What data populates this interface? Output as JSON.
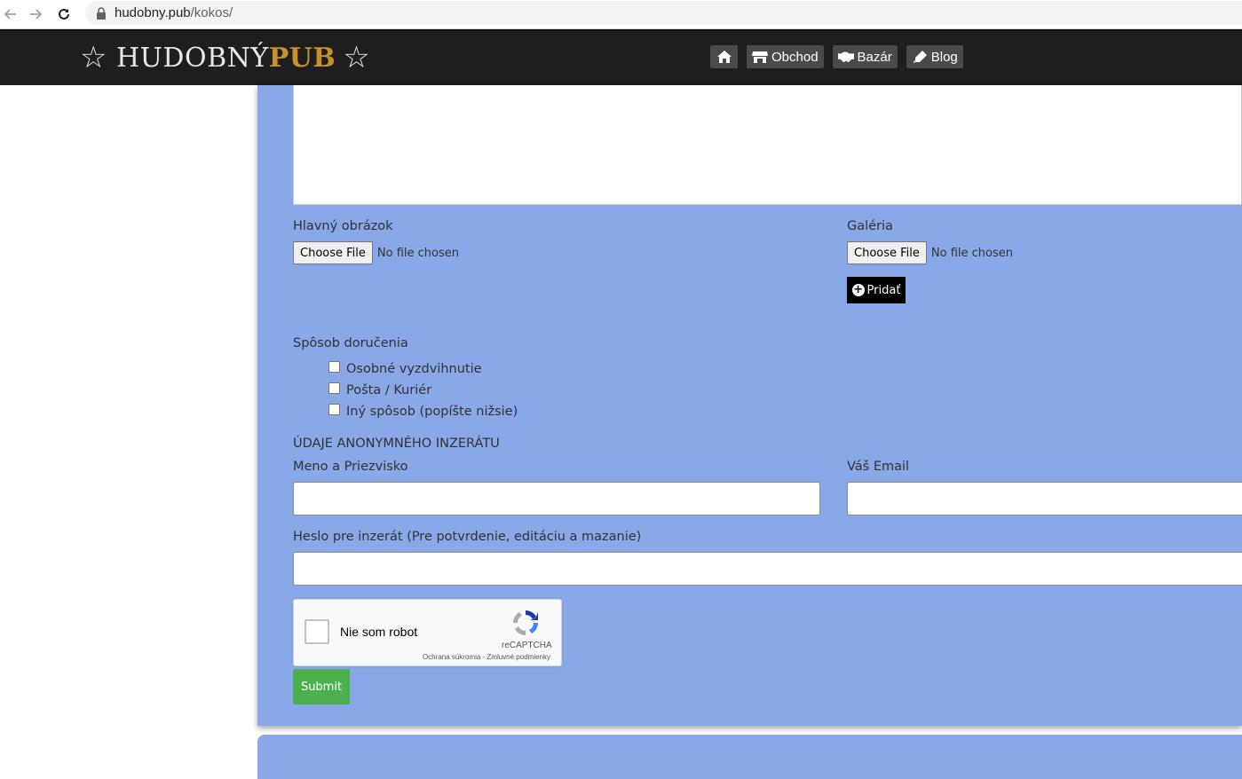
{
  "browser": {
    "url_host": "hudobny.pub",
    "url_path": "/kokos/"
  },
  "header": {
    "logo_text": "HUDOBNÝ",
    "logo_accent": "PUB",
    "star": "☆",
    "nav": [
      {
        "label": "",
        "icon": "home-icon"
      },
      {
        "label": "Obchod",
        "icon": "store-icon"
      },
      {
        "label": "Bazár",
        "icon": "handshake-icon"
      },
      {
        "label": "Blog",
        "icon": "pen-icon"
      }
    ]
  },
  "form": {
    "main_image_label": "Hlavný obrázok",
    "gallery_label": "Galéria",
    "file_button": "Choose File",
    "file_status": "No file chosen",
    "add_button": "Pridať",
    "delivery_label": "Spôsob doručenia",
    "delivery_options": [
      {
        "label": "Osobné vyzdvihnutie",
        "checked": false
      },
      {
        "label": "Pošta / Kuriér",
        "checked": false
      },
      {
        "label": "Iný spôsob (popíšte nižsie)",
        "checked": false
      }
    ],
    "anon_section_title": "ÚDAJE ANONYMNÉHO INZERÁTU",
    "name_label": "Meno a Priezvisko",
    "email_label": "Váš Email",
    "password_label": "Heslo pre inzerát (Pre potvrdenie, editáciu a mazanie)",
    "name_value": "",
    "email_value": "",
    "password_value": "",
    "recaptcha": {
      "label": "Nie som robot",
      "brand": "reCAPTCHA",
      "terms": "Ochrana súkromia - Zmluvné podmienky"
    },
    "submit_label": "Submit"
  },
  "colors": {
    "panel_bg": "#88a8e8",
    "header_bg": "#1e1e1e",
    "accent_gold": "#c8922a",
    "submit_green": "#4cb04f"
  }
}
